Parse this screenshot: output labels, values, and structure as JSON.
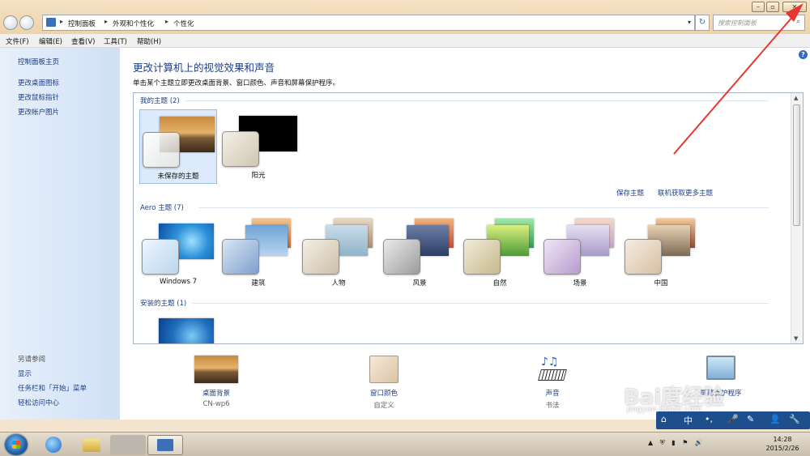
{
  "window": {
    "breadcrumb": [
      "控制面板",
      "外观和个性化",
      "个性化"
    ],
    "search_placeholder": "搜索控制面板"
  },
  "menu": [
    "文件(F)",
    "编辑(E)",
    "查看(V)",
    "工具(T)",
    "帮助(H)"
  ],
  "sidebar": {
    "home": "控制面板主页",
    "links": [
      "更改桌面图标",
      "更改鼠标指针",
      "更改帐户图片"
    ],
    "see_also_title": "另请参阅",
    "see_also": [
      "显示",
      "任务栏和「开始」菜单",
      "轻松访问中心"
    ]
  },
  "main": {
    "title": "更改计算机上的视觉效果和声音",
    "subtitle": "单击某个主题立即更改桌面背景、窗口颜色、声音和屏幕保护程序。",
    "my_themes_header": "我的主题 (2)",
    "my_themes": [
      "未保存的主题",
      "阳光"
    ],
    "save_theme": "保存主题",
    "get_more_themes": "联机获取更多主题",
    "aero_header": "Aero 主题 (7)",
    "aero_themes": [
      "Windows 7",
      "建筑",
      "人物",
      "风景",
      "自然",
      "场景",
      "中国"
    ],
    "installed_header": "安装的主题 (1)"
  },
  "bottom": {
    "desktop_bg": {
      "label": "桌面背景",
      "value": "CN-wp6"
    },
    "window_color": {
      "label": "窗口颜色",
      "value": "自定义"
    },
    "sounds": {
      "label": "声音",
      "value": "书法"
    },
    "screensaver": {
      "label": "屏幕保护程序"
    }
  },
  "taskbar": {
    "time": "14:28",
    "date": "2015/2/26"
  },
  "watermark": {
    "big": "Bai度经验",
    "small": "jingyan.baidu.com"
  },
  "ime": {
    "label": "中"
  },
  "colors": {
    "annotation_arrow": "#e8352e",
    "link": "#1e3f86"
  }
}
